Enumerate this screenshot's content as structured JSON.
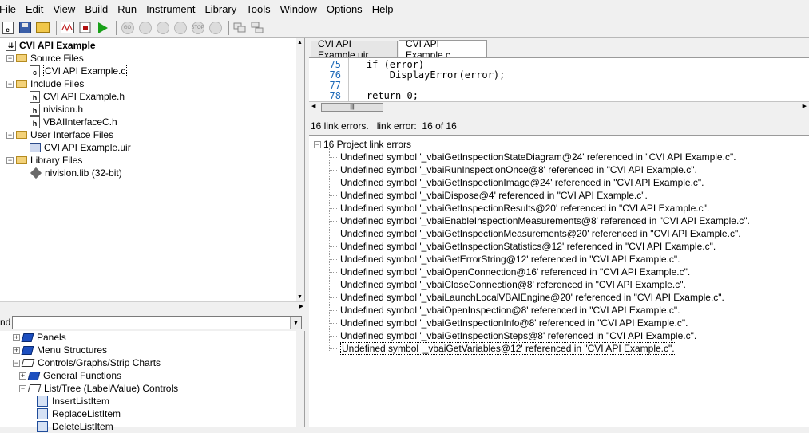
{
  "menu": [
    "File",
    "Edit",
    "View",
    "Build",
    "Run",
    "Instrument",
    "Library",
    "Tools",
    "Window",
    "Options",
    "Help"
  ],
  "toolbar": {
    "doc_letter": "c",
    "buttons": [
      "new-c-file-icon",
      "save-icon",
      "open-folder-icon",
      "waveform-icon",
      "stop-run-icon",
      "run-icon",
      "go-icon",
      "step-into-icon",
      "step-over-icon",
      "step-out-icon",
      "stop-icon",
      "step-icon",
      "breakpoint-icon",
      "tile-icon"
    ],
    "gray_labels": [
      "GO",
      "",
      "",
      "",
      "STOP",
      ""
    ]
  },
  "project_tree": {
    "root": "CVI API Example",
    "source_files": {
      "label": "Source Files",
      "items": [
        {
          "name": "CVI API Example.c",
          "type": "c"
        }
      ]
    },
    "include_files": {
      "label": "Include Files",
      "items": [
        {
          "name": "CVI API Example.h",
          "type": "h"
        },
        {
          "name": "nivision.h",
          "type": "h"
        },
        {
          "name": "VBAIInterfaceC.h",
          "type": "h"
        }
      ]
    },
    "ui_files": {
      "label": "User Interface Files",
      "items": [
        {
          "name": "CVI API Example.uir",
          "type": "uir"
        }
      ]
    },
    "library_files": {
      "label": "Library Files",
      "items": [
        {
          "name": "nivision.lib (32-bit)",
          "type": "lib"
        }
      ]
    }
  },
  "find": {
    "label": "nd",
    "value": ""
  },
  "library_tree": [
    {
      "label": "Panels",
      "level": 0,
      "expander": "+",
      "icon": "book"
    },
    {
      "label": "Menu Structures",
      "level": 0,
      "expander": "+",
      "icon": "book"
    },
    {
      "label": "Controls/Graphs/Strip Charts",
      "level": 0,
      "expander": "−",
      "icon": "book-open"
    },
    {
      "label": "General Functions",
      "level": 1,
      "expander": "+",
      "icon": "book"
    },
    {
      "label": "List/Tree (Label/Value) Controls",
      "level": 1,
      "expander": "−",
      "icon": "book-open"
    },
    {
      "label": "InsertListItem",
      "level": 2,
      "expander": "",
      "icon": "fn"
    },
    {
      "label": "ReplaceListItem",
      "level": 2,
      "expander": "",
      "icon": "fn"
    },
    {
      "label": "DeleteListItem",
      "level": 2,
      "expander": "",
      "icon": "fn"
    }
  ],
  "tabs": [
    {
      "label": "CVI API Example.uir",
      "active": false
    },
    {
      "label": "CVI API Example.c",
      "active": true
    }
  ],
  "code": [
    {
      "num": "75",
      "text": "    if (error)"
    },
    {
      "num": "76",
      "text": "        DisplayError(error);"
    },
    {
      "num": "77",
      "text": ""
    },
    {
      "num": "78",
      "text": "    return 0;"
    }
  ],
  "status": {
    "count": "16 link errors.",
    "position": "link error:  16 of 16"
  },
  "errors": {
    "header": "16 Project link errors",
    "expander": "−",
    "items": [
      "Undefined symbol '_vbaiGetInspectionStateDiagram@24' referenced in \"CVI API Example.c\".",
      "Undefined symbol '_vbaiRunInspectionOnce@8' referenced in \"CVI API Example.c\".",
      "Undefined symbol '_vbaiGetInspectionImage@24' referenced in \"CVI API Example.c\".",
      "Undefined symbol '_vbaiDispose@4' referenced in \"CVI API Example.c\".",
      "Undefined symbol '_vbaiGetInspectionResults@20' referenced in \"CVI API Example.c\".",
      "Undefined symbol '_vbaiEnableInspectionMeasurements@8' referenced in \"CVI API Example.c\".",
      "Undefined symbol '_vbaiGetInspectionMeasurements@20' referenced in \"CVI API Example.c\".",
      "Undefined symbol '_vbaiGetInspectionStatistics@12' referenced in \"CVI API Example.c\".",
      "Undefined symbol '_vbaiGetErrorString@12' referenced in \"CVI API Example.c\".",
      "Undefined symbol '_vbaiOpenConnection@16' referenced in \"CVI API Example.c\".",
      "Undefined symbol '_vbaiCloseConnection@8' referenced in \"CVI API Example.c\".",
      "Undefined symbol '_vbaiLaunchLocalVBAIEngine@20' referenced in \"CVI API Example.c\".",
      "Undefined symbol '_vbaiOpenInspection@8' referenced in \"CVI API Example.c\".",
      "Undefined symbol '_vbaiGetInspectionInfo@8' referenced in \"CVI API Example.c\".",
      "Undefined symbol '_vbaiGetInspectionSteps@8' referenced in \"CVI API Example.c\".",
      "Undefined symbol '_vbaiGetVariables@12' referenced in \"CVI API Example.c\"."
    ]
  },
  "colors": {
    "line_numbers": "#1e6ab8",
    "run_green": "#18a018",
    "folder_yellow": "#f3d27a"
  }
}
